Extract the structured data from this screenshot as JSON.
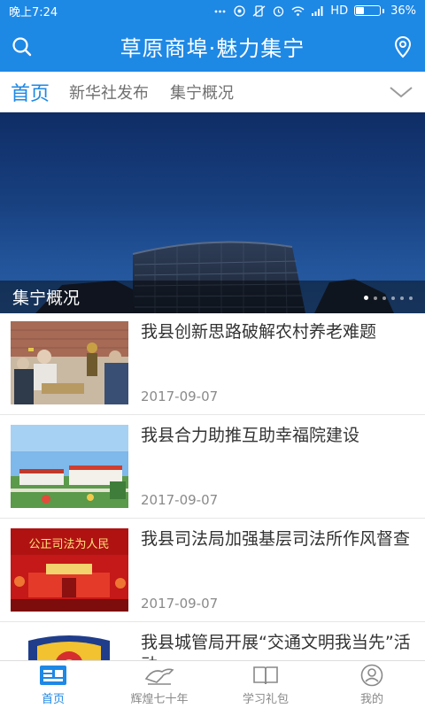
{
  "status": {
    "time": "晚上7:24",
    "network": "HD",
    "battery": "36%",
    "battery_level": 0.36
  },
  "header": {
    "title": "草原商埠·魅力集宁",
    "left_icon": "search-icon",
    "right_icon": "location-pin-icon"
  },
  "tabs": [
    {
      "label": "首页",
      "active": true
    },
    {
      "label": "新华社发布",
      "active": false
    },
    {
      "label": "集宁概况",
      "active": false
    }
  ],
  "banner": {
    "caption": "集宁概况",
    "slides": 6,
    "active_slide": 1
  },
  "news": [
    {
      "title": "我县创新思路破解农村养老难题",
      "date": "2017-09-07",
      "thumb": "elders-playing-chess"
    },
    {
      "title": "我县合力助推互助幸福院建设",
      "date": "2017-09-07",
      "thumb": "welfare-courtyard"
    },
    {
      "title": "我县司法局加强基层司法所作风督查",
      "date": "2017-09-07",
      "thumb": "justice-banner",
      "thumb_text": "公正司法为人民"
    },
    {
      "title": "我县城管局开展“交通文明我当先”活动",
      "date": "",
      "thumb": "police-emblem"
    }
  ],
  "bottom_nav": [
    {
      "label": "首页",
      "icon": "home-icon",
      "active": true
    },
    {
      "label": "辉煌七十年",
      "icon": "horse-icon",
      "active": false
    },
    {
      "label": "学习礼包",
      "icon": "book-icon",
      "active": false
    },
    {
      "label": "我的",
      "icon": "profile-icon",
      "active": false
    }
  ],
  "colors": {
    "primary": "#1e88e5",
    "text": "#333333",
    "muted": "#8a8a8a"
  }
}
